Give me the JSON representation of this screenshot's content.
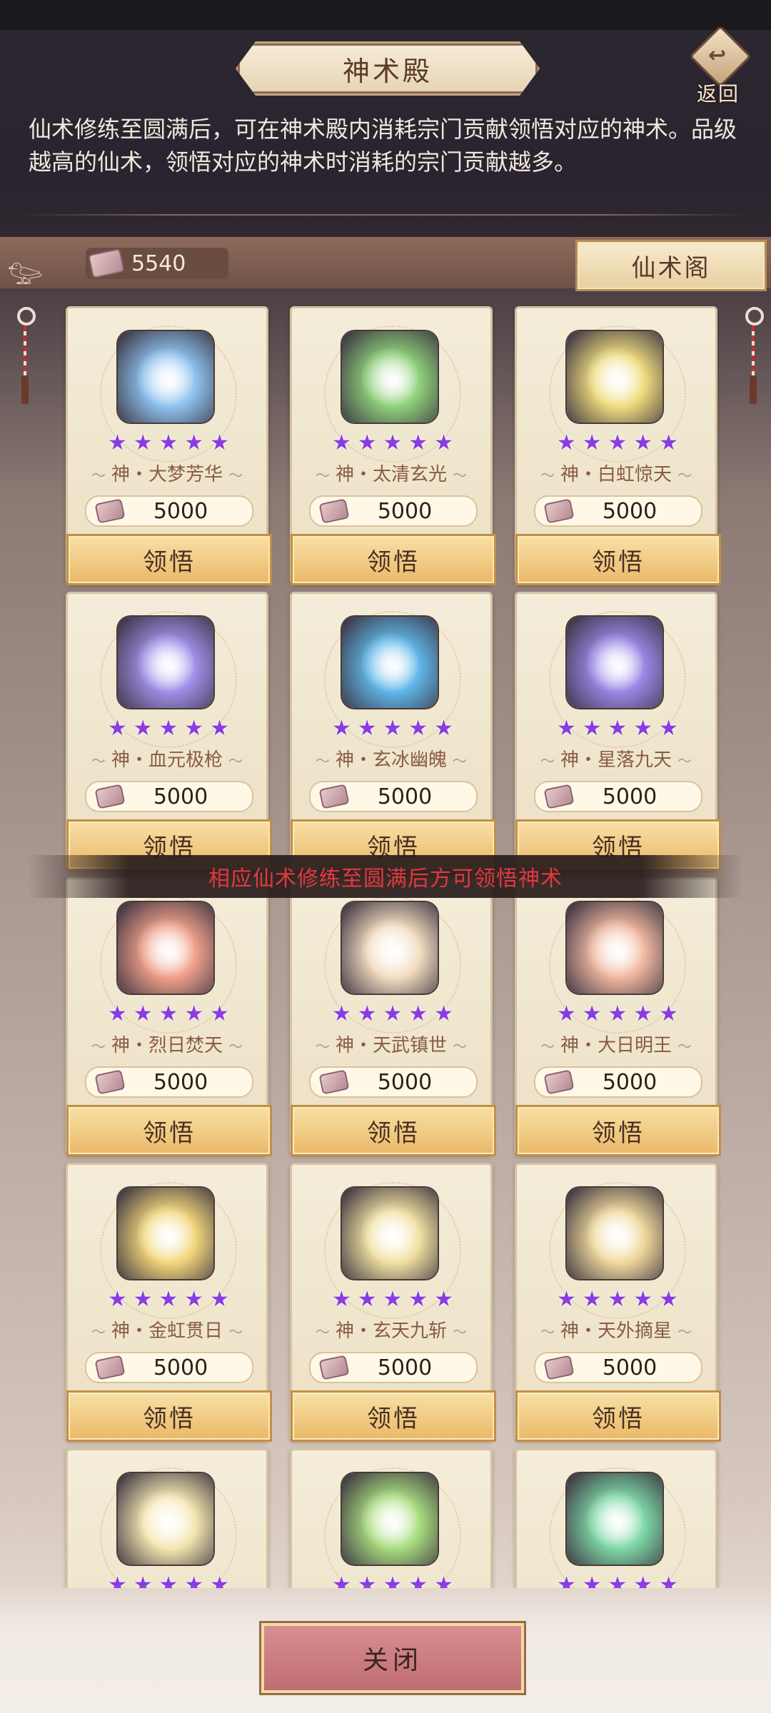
{
  "header": {
    "title": "神术殿",
    "back_label": "返回",
    "description": "仙术修练至圆满后，可在神术殿内消耗宗门贡献领悟对应的神术。品级越高的仙术，领悟对应的神术时消耗的宗门贡献越多。"
  },
  "currency": {
    "value": "5540",
    "icon": "contribution-token-icon"
  },
  "pavilion_button": "仙术阁",
  "learn_label": "领悟",
  "stars_per_skill": 5,
  "skills": [
    {
      "name": "神・大梦芳华",
      "cost": "5000",
      "color": "#8ec3f0"
    },
    {
      "name": "神・太清玄光",
      "cost": "5000",
      "color": "#8fd07a"
    },
    {
      "name": "神・白虹惊天",
      "cost": "5000",
      "color": "#efdc7e"
    },
    {
      "name": "神・血元极枪",
      "cost": "5000",
      "color": "#9f8ee8"
    },
    {
      "name": "神・玄冰幽魄",
      "cost": "5000",
      "color": "#5fb6e8"
    },
    {
      "name": "神・星落九天",
      "cost": "5000",
      "color": "#9a86e6"
    },
    {
      "name": "神・烈日焚天",
      "cost": "5000",
      "color": "#f1a08a"
    },
    {
      "name": "神・天武镇世",
      "cost": "5000",
      "color": "#f3dcc0"
    },
    {
      "name": "神・大日明王",
      "cost": "5000",
      "color": "#f0b7a0"
    },
    {
      "name": "神・金虹贯日",
      "cost": "5000",
      "color": "#f2d67a"
    },
    {
      "name": "神・玄天九斩",
      "cost": "5000",
      "color": "#f0e0a0"
    },
    {
      "name": "神・天外摘星",
      "cost": "5000",
      "color": "#efd79a"
    },
    {
      "name": "",
      "cost": "",
      "color": "#f4e6b0"
    },
    {
      "name": "",
      "cost": "",
      "color": "#a9dc7e"
    },
    {
      "name": "",
      "cost": "",
      "color": "#7ed7a6"
    }
  ],
  "toast": "相应仙术修练至圆满后方可领悟神术",
  "close_label": "关闭"
}
